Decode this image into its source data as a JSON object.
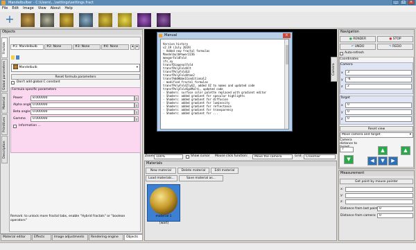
{
  "window": {
    "title": "Mandelbulber - C:\\Users\\...\\settings\\settings.fract"
  },
  "menu": [
    "File",
    "Edit",
    "Image",
    "View",
    "About",
    "Help"
  ],
  "objects_panel": {
    "header": "Objects",
    "vtabs": [
      "Fractals",
      "Global parameters",
      "Material",
      "Primitives",
      "Description"
    ],
    "fractal_tabs": [
      "#1: Mandelbulb",
      "#2: None",
      "#3: None",
      "#4: None"
    ],
    "formula": "Mandelbulb",
    "reset_label": "Reset formula parameters",
    "dont_add_c": "Don't add global C constant",
    "specific_header": "Formula specific parameters",
    "params": [
      {
        "label": "Power",
        "value": "8.000000"
      },
      {
        "label": "Alpha angle offset",
        "value": "0.000000"
      },
      {
        "label": "Beta angle offset",
        "value": "0.000000"
      },
      {
        "label": "Gamma",
        "value": "0.000000"
      }
    ],
    "info_label": "Information ...",
    "remark": "Remark: to unlock more fractal tabs, enable \"Hybrid fractals\" or \"boolean operators\""
  },
  "bottom_tabs": [
    "Material editor",
    "Effects",
    "Image adjustments",
    "Rendering engine",
    "Objects"
  ],
  "status": {
    "zoom_label": "Zoom:",
    "zoom_value": "100%",
    "show_cursor": "Show cursor",
    "mouse_fn_label": "Mouse click function:",
    "mouse_fn_value": "Move the camera",
    "grid_label": "Grid:",
    "grid_value": "Crosshair"
  },
  "materials": {
    "header": "Materials",
    "new": "New material",
    "delete": "Delete material",
    "edit": "Edit material",
    "load": "Load materials...",
    "save": "Save material as...",
    "item_name": "material 1",
    "item_sub": "[wait]"
  },
  "dialog": {
    "title": "Manual",
    "heading": "Version history",
    "lines": [
      "v2.19 (July 2019)",
      "- Added new fractal formulas",
      "   MandelbulbPower2236",
      "   mengerFoldFold",
      "   ifs_xy",
      "   transfDiagonalFold",
      "   transfPolyFoldAlt",
      "   transfPolyFoldLU",
      "   transfPolyFoldAtan2",
      "   transfAddHbbe1Conditional2",
      "- modified fractal formulas",
      "   transfPolyFold2lyU2, added XZ to names and updated code",
      "   transfPolyFoldSymMulti, updated code",
      "- Shaders: surface color palette replaced with gradient editor",
      "- Shaders: added gradient for specular highlights",
      "- Shaders: added gradient for diffusion",
      "- Shaders: added gradient for luminosity",
      "- Shaders: added gradient for reflectance",
      "- Shaders: added gradient for transparency",
      "- Shaders: added gradient for ..."
    ]
  },
  "navigation": {
    "header": "Navigation",
    "render": "RENDER",
    "stop": "STOP",
    "undo": "UNDO",
    "redo": "REDO",
    "auto_refresh": "Auto-refresh",
    "coords": "Coordinates",
    "camera": "Camera",
    "target": "Target",
    "cam": [
      {
        "axis": "x",
        "value": "3"
      },
      {
        "axis": "y",
        "value": "-6"
      },
      {
        "axis": "z",
        "value": "2"
      }
    ],
    "tgt": [
      {
        "axis": "x",
        "value": "0"
      },
      {
        "axis": "y",
        "value": "0"
      },
      {
        "axis": "z",
        "value": "0"
      }
    ],
    "reset": "Reset view",
    "move_mode": "Move camera and target",
    "dist_label": "Camera distance to target:",
    "dist_value": "7"
  },
  "measurement": {
    "header": "Measurement",
    "get_point": "Get point by mouse pointer",
    "rows": [
      "x:",
      "y:",
      "z:"
    ],
    "dist_last": "Distance from last point:",
    "dist_cam": "Distance from camera:",
    "dist_last_value": "0",
    "dist_cam_value": "0"
  },
  "colors": {
    "accent": "#5b8bb5",
    "param_bg": "#fbd8f0",
    "viewport": "#000000",
    "green": "#2ba84a",
    "blue": "#2f6fb6",
    "red": "#c9372c"
  }
}
